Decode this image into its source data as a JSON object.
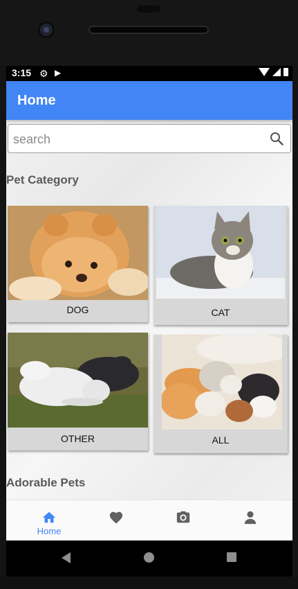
{
  "status_bar": {
    "time": "3:15",
    "settings_icon": "gear-icon",
    "media_icon": "play-store-icon"
  },
  "app_bar": {
    "title": "Home"
  },
  "search": {
    "placeholder": "search",
    "value": "",
    "icon": "search-icon"
  },
  "sections": {
    "pet_category": "Pet Category",
    "adorable_pets": "Adorable Pets"
  },
  "categories": [
    {
      "label": "DOG",
      "image": "pomeranian-puppy-photo"
    },
    {
      "label": "CAT",
      "image": "tabby-kitten-photo"
    },
    {
      "label": "OTHER",
      "image": "rabbits-on-grass-photo"
    },
    {
      "label": "ALL",
      "image": "cats-and-dogs-photo"
    }
  ],
  "bottom_nav": [
    {
      "icon": "home-icon",
      "label": "Home",
      "active": true
    },
    {
      "icon": "heart-icon",
      "label": "",
      "active": false
    },
    {
      "icon": "camera-icon",
      "label": "",
      "active": false
    },
    {
      "icon": "person-icon",
      "label": "",
      "active": false
    }
  ],
  "colors": {
    "primary": "#4285f4",
    "card_bg": "#d7d7d7",
    "inactive_icon": "#616161"
  }
}
